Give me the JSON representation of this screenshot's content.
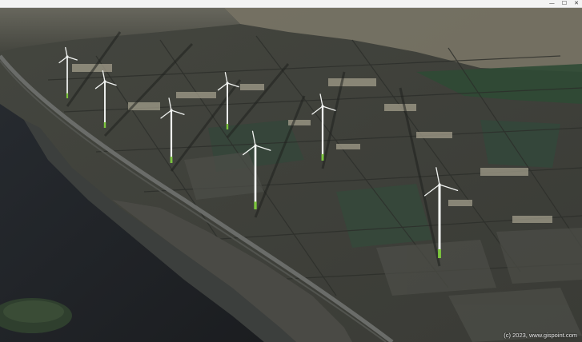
{
  "window": {
    "controls": {
      "minimize": "—",
      "maximize": "☐",
      "close": "✕"
    }
  },
  "map": {
    "view": "3D aerial terrain with wind turbines",
    "copyright": "(c) 2023, www.gispoint.com",
    "turbine_count": 7,
    "colors": {
      "water": "#1f2226",
      "fields": "#3a3c38",
      "green_fields": "#35463a",
      "town": "#8f8a7a",
      "road": "#5d5f5c",
      "turbine": "#f2f4f2",
      "turbine_base": "#7cc63d"
    }
  }
}
